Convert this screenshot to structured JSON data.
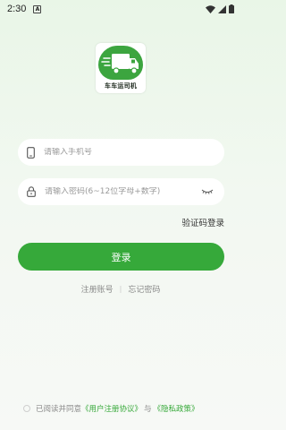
{
  "status_bar": {
    "time": "2:30",
    "notification_letter": "A"
  },
  "logo": {
    "text": "车车运司机"
  },
  "form": {
    "phone_placeholder": "请输入手机号",
    "password_placeholder": "请输入密码(6~12位字母+数字)"
  },
  "sms_login_label": "验证码登录",
  "login_button_label": "登录",
  "links": {
    "register": "注册账号",
    "forgot": "忘记密码"
  },
  "agreement": {
    "prefix": "已阅读并同意",
    "user_agreement": "《用户注册协议》",
    "and": "与",
    "privacy_policy": "《隐私政策》"
  },
  "colors": {
    "primary": "#36a93a",
    "background_top": "#e9f6e7"
  }
}
